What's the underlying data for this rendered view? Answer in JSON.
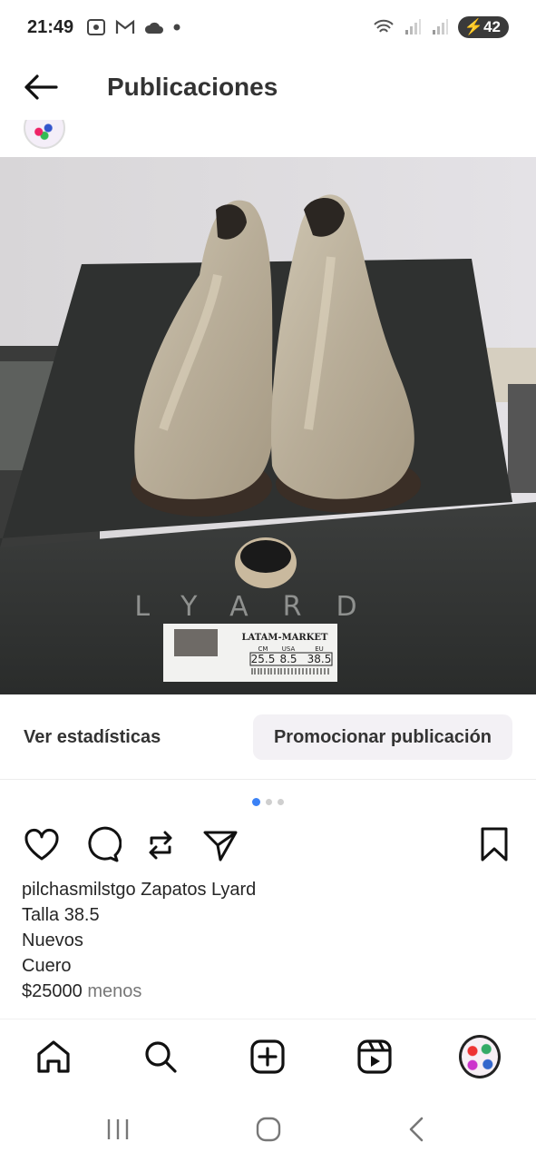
{
  "status_bar": {
    "time": "21:49",
    "battery": "42",
    "icons": [
      "screenshot-icon",
      "gmail-icon",
      "cloud-icon",
      "dot-icon",
      "wifi-icon",
      "signal-icon",
      "signal-icon",
      "battery-icon"
    ]
  },
  "header": {
    "title": "Publicaciones"
  },
  "post": {
    "image_brand_text": "LYARD",
    "label": {
      "title": "LATAM-MARKET",
      "cols": [
        "CM",
        "USA",
        "EU"
      ],
      "vals": [
        "25.5",
        "8.5",
        "38.5"
      ]
    },
    "stats_label": "Ver estadísticas",
    "promote_label": "Promocionar publicación",
    "carousel": {
      "count": 3,
      "active": 0
    },
    "username": "pilchasmilstgo",
    "caption_first": "Zapatos Lyard",
    "caption_lines": [
      "Talla 38.5",
      "Nuevos",
      "Cuero"
    ],
    "price": "$25000",
    "price_suffix": "menos"
  },
  "bottom_nav": {
    "items": [
      "home-icon",
      "search-icon",
      "create-icon",
      "reels-icon",
      "profile-avatar"
    ]
  },
  "colors": {
    "accent": "#3b82f6",
    "text": "#262626",
    "muted": "#777777",
    "promo_bg": "#f3f1f5"
  }
}
